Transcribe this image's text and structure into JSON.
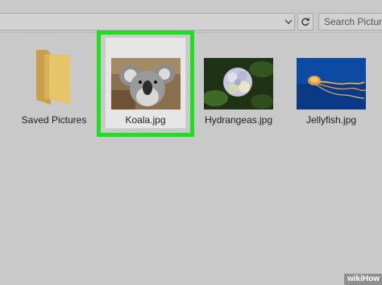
{
  "search": {
    "placeholder": "Search Pictures"
  },
  "items": [
    {
      "label": "Saved Pictures",
      "kind": "folder"
    },
    {
      "label": "Koala.jpg",
      "kind": "image",
      "selected": true
    },
    {
      "label": "Hydrangeas.jpg",
      "kind": "image"
    },
    {
      "label": "Jellyfish.jpg",
      "kind": "image"
    }
  ],
  "colors": {
    "selection": "#1ee01e",
    "folder": "#e8c468",
    "background": "#c9c9c9"
  },
  "watermark": {
    "text": "wikiHow"
  }
}
